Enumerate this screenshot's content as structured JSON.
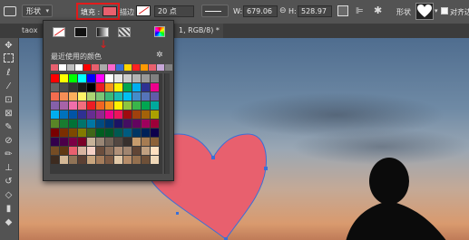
{
  "options_bar": {
    "shape_mode": "形状",
    "fill_label": "填充 :",
    "fill_color": "#e8606e",
    "stroke_label": "描边 :",
    "stroke_size": "20 点",
    "width_label": "W:",
    "width_value": "679.06",
    "link_icon": "link-icon",
    "height_label": "H:",
    "height_value": "528.97",
    "shape_label": "形状",
    "align_edges_label": "对齐边"
  },
  "tabs": [
    {
      "label": "taox"
    },
    {
      "label": "1, RGB/8) *"
    }
  ],
  "fill_popup": {
    "recent_label": "最近使用的颜色",
    "recent_colors": [
      "#e8606e",
      "#ffffff",
      "#bdbdbd",
      "#ffffff",
      "#ff0000",
      "#e8606e",
      "#aaaaaa",
      "#ff66cc",
      "#3a6fd8",
      "#ffd400",
      "#ff2222",
      "#ff9900",
      "#e8606e",
      "#c7a7d8",
      "#808080"
    ],
    "swatches": [
      "#ff0000",
      "#ffff00",
      "#00ff00",
      "#00ffff",
      "#0000ff",
      "#ff00ff",
      "#ffffff",
      "#e6e6e6",
      "#cccccc",
      "#b3b3b3",
      "#999999",
      "#808080",
      "#666666",
      "#4d4d4d",
      "#333333",
      "#1a1a1a",
      "#000000",
      "#ed1c24",
      "#f7941d",
      "#fff200",
      "#00a651",
      "#00aeef",
      "#2e3192",
      "#ec008c",
      "#f26c4f",
      "#f68e56",
      "#fbaf5d",
      "#fff568",
      "#acd373",
      "#7cc576",
      "#3bb878",
      "#1abbb4",
      "#00bff3",
      "#438ccb",
      "#5574b9",
      "#605ca8",
      "#8560a8",
      "#a763a8",
      "#f06eaa",
      "#f26d7d",
      "#ed1c24",
      "#f26522",
      "#f7941d",
      "#fff200",
      "#8dc63f",
      "#39b54a",
      "#00a651",
      "#00a99d",
      "#00aeef",
      "#0072bc",
      "#0054a6",
      "#2e3192",
      "#662d91",
      "#92278f",
      "#ec008c",
      "#ed145b",
      "#9e0b0f",
      "#a0410d",
      "#a36209",
      "#aba000",
      "#598527",
      "#197b30",
      "#007236",
      "#00746b",
      "#0076a3",
      "#004a80",
      "#003471",
      "#1b1464",
      "#440e62",
      "#630460",
      "#9e005d",
      "#9e0039",
      "#790000",
      "#7b2e00",
      "#7d4900",
      "#827b00",
      "#406618",
      "#005e20",
      "#005826",
      "#005952",
      "#005b7f",
      "#003663",
      "#002157",
      "#0d004c",
      "#32004b",
      "#4b0049",
      "#7b0046",
      "#7a0026",
      "#c7b299",
      "#998675",
      "#736357",
      "#534741",
      "#37302d",
      "#c69c6d",
      "#a67c52",
      "#8c6239",
      "#754c24",
      "#603913",
      "#e8606e",
      "#d8b4a0",
      "#f5d0c5",
      "#6b4e3d",
      "#8a6e5a",
      "#b09078",
      "#a08570",
      "#604535",
      "#c0a080",
      "#ffe0c0",
      "#3d2b1f",
      "#d4b896",
      "#8f7356",
      "#5c4033",
      "#c8a57e",
      "#a47c5b",
      "#7d5a44",
      "#e2c9a8",
      "#b68d6a",
      "#94704f",
      "#6e5038",
      "#f0d8b8"
    ]
  }
}
